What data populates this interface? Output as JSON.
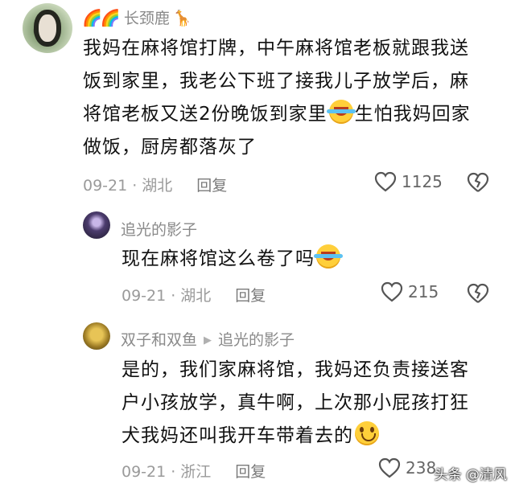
{
  "comments": [
    {
      "username": "长颈鹿",
      "text_parts": [
        "我妈在麻将馆打牌，中午麻将馆老板就跟我送",
        "饭到家里，我老公下班了接我儿子放学后，麻",
        "将馆老板又送2份晚饭到家里",
        "生怕我妈回家",
        "做饭，厨房都落灰了"
      ],
      "date": "09-21",
      "location": "湖北",
      "reply_label": "回复",
      "likes": "1125"
    },
    {
      "username": "追光的影子",
      "text": "现在麻将馆这么卷了吗",
      "date": "09-21",
      "location": "湖北",
      "reply_label": "回复",
      "likes": "215"
    },
    {
      "username": "双子和双鱼",
      "reply_to": "追光的影子",
      "text_parts": [
        "是的，我们家麻将馆，我妈还负责接送客",
        "户小孩放学，真牛啊，上次那小屁孩打狂",
        "犬我妈还叫我开车带着去的"
      ],
      "date": "09-21",
      "location": "浙江",
      "reply_label": "回复",
      "likes": "238"
    }
  ],
  "watermark": "头条 @清风",
  "colors": {
    "meta": "#9a9a9a",
    "text": "#111111",
    "emoji": "#ffcf3a"
  },
  "icons": [
    "avatar",
    "rainbow-icon",
    "giraffe-icon",
    "crying-laughing-emoji",
    "smile-emoji",
    "heart-icon",
    "broken-heart-icon",
    "reply-arrow-icon"
  ]
}
